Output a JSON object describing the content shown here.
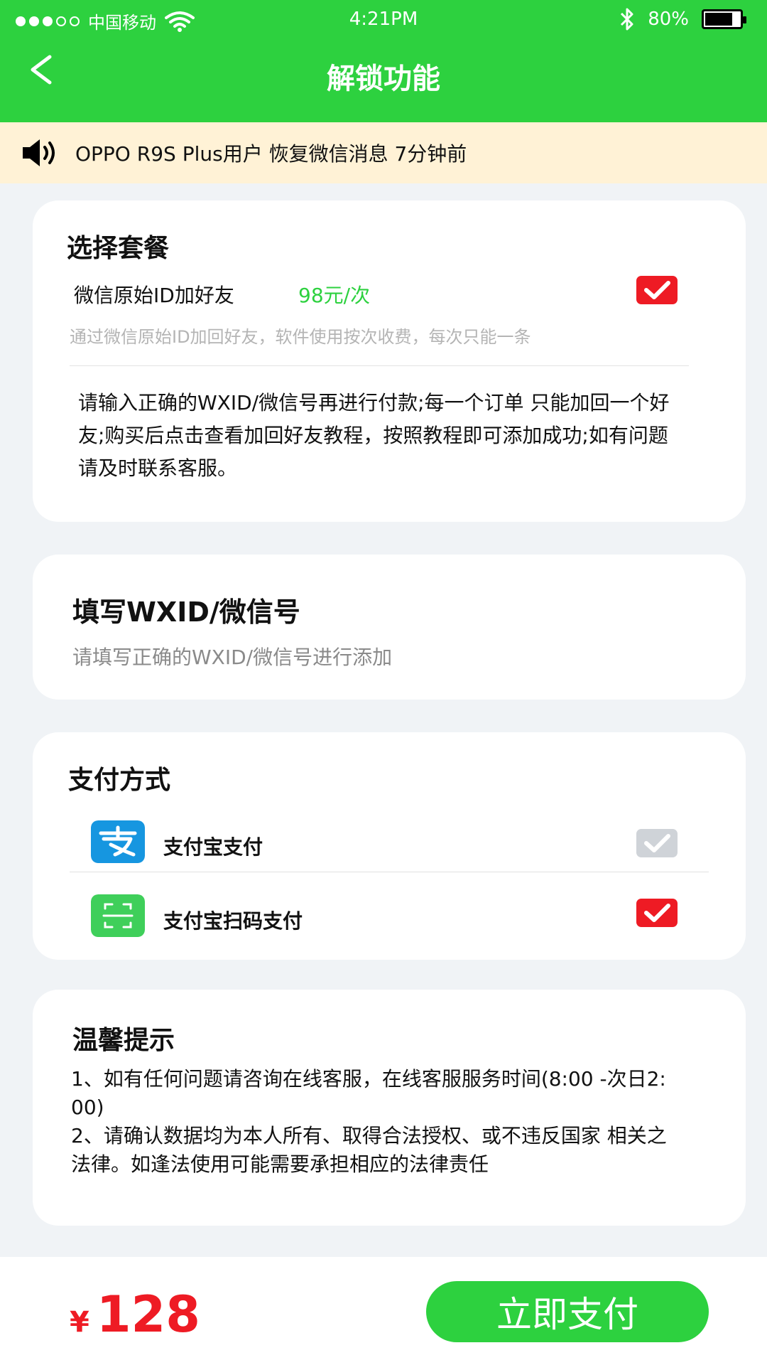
{
  "status": {
    "carrier": "中国移动",
    "time": "4:21PM",
    "battery": "80%",
    "battery_level": 0.8
  },
  "nav": {
    "back_icon": "chevron-left-icon",
    "title": "解锁功能"
  },
  "notice": {
    "icon": "speaker-icon",
    "text": "OPPO R9S Plus用户 恢复微信消息 7分钟前"
  },
  "package": {
    "title": "选择套餐",
    "name": "微信原始ID加好友",
    "price": "98元/次",
    "selected": true,
    "description": "通过微信原始ID加回好友，软件使用按次收费，每次只能一条",
    "notice": "请输入正确的WXID/微信号再进行付款;每一个订单 只能加回一个好友;购买后点击查看加回好友教程，按照教程即可添加成功;如有问题请及时联系客服。"
  },
  "wxid": {
    "title": "填写WXID/微信号",
    "placeholder": "请填写正确的WXID/微信号进行添加",
    "value": ""
  },
  "payment": {
    "title": "支付方式",
    "methods": [
      {
        "label": "支付宝支付",
        "icon": "alipay-icon",
        "selected": false
      },
      {
        "label": "支付宝扫码支付",
        "icon": "qr-scan-icon",
        "selected": true
      }
    ]
  },
  "tips": {
    "title": "温馨提示",
    "line1": "1、如有任何问题请咨询在线客服，在线客服服务时间(8:00 -次日2: 00)",
    "line2": "2、请确认数据均为本人所有、取得合法授权、或不违反国家 相关之法律。如逢法使用可能需要承担相应的法律责任"
  },
  "checkout": {
    "currency": "¥",
    "total": "128",
    "pay_label": "立即支付"
  },
  "colors": {
    "brand_green": "#2dd13f",
    "accent_red": "#ee1b24",
    "notice_bg": "#fff2d6",
    "page_bg": "#f0f3f6"
  }
}
